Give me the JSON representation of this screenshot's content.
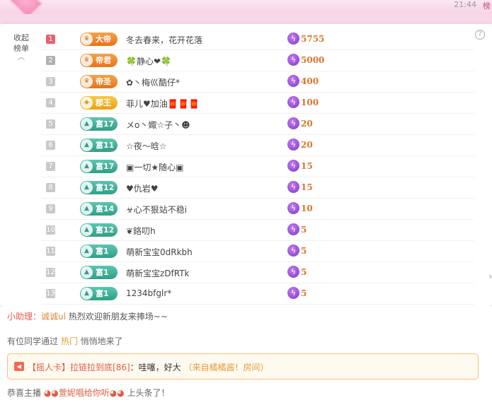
{
  "top": {
    "time": "21:44",
    "right_char": "榜"
  },
  "panel": {
    "collapse_label": "收起\n榜单",
    "help_icon": "?",
    "rows": [
      {
        "rank": "1",
        "badge": "大帝",
        "badge_type": "emperor",
        "badge_icon": "crown-icon",
        "name": "冬去春来，花开花落",
        "amount": "5755"
      },
      {
        "rank": "2",
        "badge": "帝君",
        "badge_type": "emperor",
        "badge_icon": "crown-icon",
        "name": "🍀静心❤🍀",
        "amount": "5000"
      },
      {
        "rank": "3",
        "badge": "帝圣",
        "badge_type": "emperor",
        "badge_icon": "crown-icon",
        "name": "✿丶梅巛酷仔*",
        "amount": "400"
      },
      {
        "rank": "4",
        "badge": "郡王",
        "badge_type": "king",
        "badge_icon": "medal-icon",
        "name": "菲儿♥加油🧧🧧🧧",
        "amount": "100"
      },
      {
        "rank": "5",
        "badge": "富17",
        "badge_type": "rich",
        "badge_icon": "level-icon",
        "name": "メo丶娵☆子丶☻",
        "amount": "20"
      },
      {
        "rank": "6",
        "badge": "富11",
        "badge_type": "rich",
        "badge_icon": "level-icon",
        "name": "☆夜～晗☆",
        "amount": "20"
      },
      {
        "rank": "7",
        "badge": "富17",
        "badge_type": "rich",
        "badge_icon": "level-icon",
        "name": "▣一切★随心▣",
        "amount": "15"
      },
      {
        "rank": "8",
        "badge": "富12",
        "badge_type": "rich",
        "badge_icon": "level-icon",
        "name": "♥仇岩♥",
        "amount": "15"
      },
      {
        "rank": "9",
        "badge": "富14",
        "badge_type": "rich",
        "badge_icon": "level-icon",
        "name": "☣心不狠站不稳i",
        "amount": "10"
      },
      {
        "rank": "10",
        "badge": "富12",
        "badge_type": "rich",
        "badge_icon": "level-icon",
        "name": "❦鉻叨h",
        "amount": "5"
      },
      {
        "rank": "11",
        "badge": "富1",
        "badge_type": "rich",
        "badge_icon": "level-icon",
        "name": "萌新宝宝0dRkbh",
        "amount": "5"
      },
      {
        "rank": "12",
        "badge": "富1",
        "badge_type": "rich",
        "badge_icon": "level-icon",
        "name": "萌新宝宝zDfRTk",
        "amount": "5"
      },
      {
        "rank": "13",
        "badge": "富1",
        "badge_type": "rich",
        "badge_icon": "level-icon",
        "name": "1234bfglr*",
        "amount": "5"
      }
    ]
  },
  "chat": {
    "helper": {
      "name": "小助理：",
      "user": "诚诚ul",
      "text": " 热烈欢迎新朋友来捧场~~"
    },
    "join": {
      "prefix": "有位同学通过 ",
      "hot": "热门",
      "suffix": " 悄悄地来了"
    },
    "shake": {
      "tag": "【摇人卡】",
      "who": "拉链拉到底[86]",
      "sep": "：",
      "content": "哇噻，好大 ",
      "source": "（来自橘橘酱！房间）"
    },
    "headline": {
      "prefix": "恭喜主播 ",
      "anchor": "◕◕萱妮唱给你听◕◕",
      "suffix": " 上头条了！"
    }
  },
  "colors": {
    "accent": "#e05c45",
    "amount": "#d9762b",
    "rich_badge": "#2f9f86",
    "emperor_badge": "#e67417"
  }
}
